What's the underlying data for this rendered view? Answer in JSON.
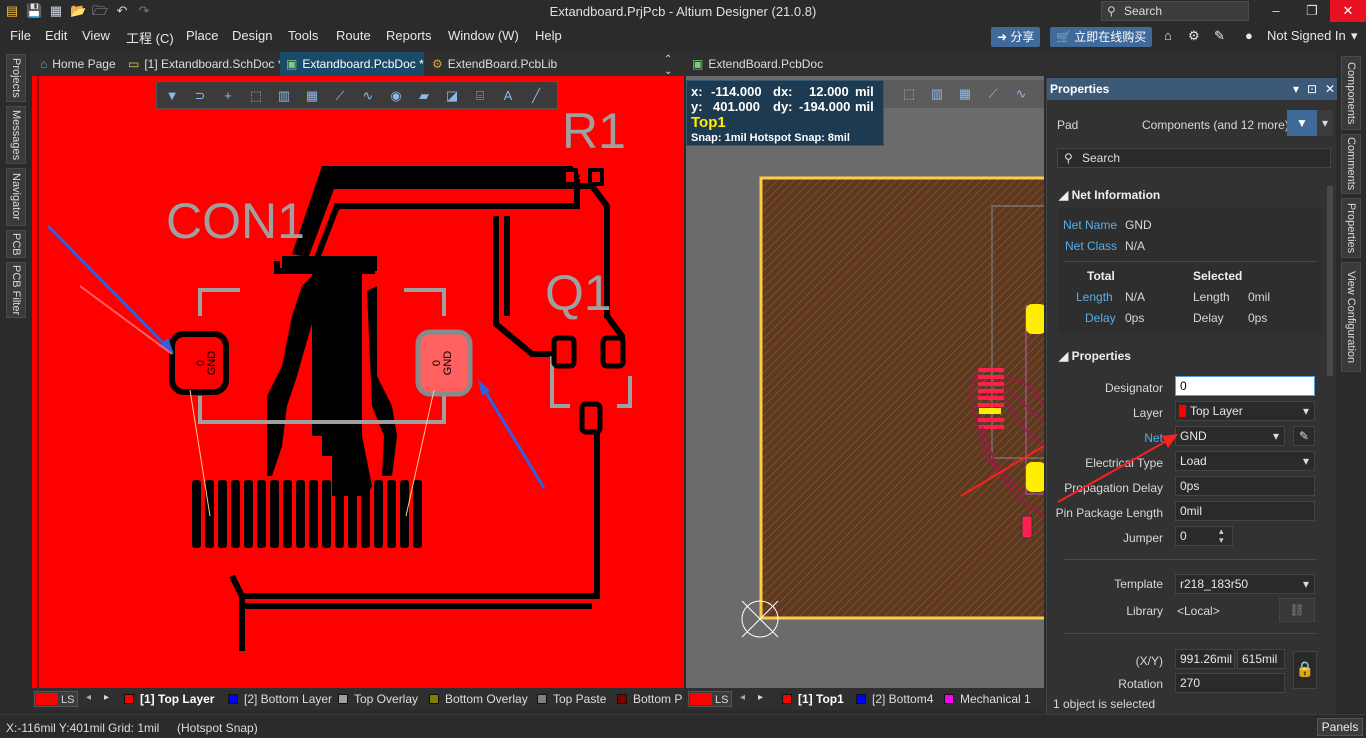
{
  "window": {
    "title": "Extandboard.PrjPcb - Altium Designer (21.0.8)",
    "search_placeholder": "Search",
    "minimize": "–",
    "restore": "❐",
    "close": "✕"
  },
  "menu": {
    "items": [
      "File",
      "Edit",
      "View",
      "工程 (C)",
      "Place",
      "Design",
      "Tools",
      "Route",
      "Reports",
      "Window (W)",
      "Help"
    ],
    "share_label": "分享",
    "buy_label": "立即在线购买",
    "user_label": "Not Signed In"
  },
  "tabs": {
    "left": [
      {
        "label": "Home Page",
        "icon": "home-icon"
      },
      {
        "label": "[1] Extandboard.SchDoc *",
        "icon": "schematic-icon"
      },
      {
        "label": "Extandboard.PcbDoc *",
        "icon": "pcb-icon"
      },
      {
        "label": "ExtendBoard.PcbLib",
        "icon": "library-icon"
      }
    ],
    "right": {
      "label": "ExtendBoard.PcbDoc",
      "icon": "pcb-icon"
    }
  },
  "left_dock": [
    "Projects",
    "Messages",
    "Navigator",
    "PCB",
    "PCB Filter"
  ],
  "right_dock": [
    "Components",
    "Comments",
    "Properties",
    "View Configuration"
  ],
  "pcb_left": {
    "designators": [
      "R1",
      "CON1",
      "Q1"
    ],
    "pad_label_num": "0",
    "pad_label_net": "GND"
  },
  "coords": {
    "x_label": "x:",
    "x_val": "-114.000",
    "dx_label": "dx:",
    "dx_val": "12.000",
    "x_unit": "mil",
    "y_label": "y:",
    "y_val": "401.000",
    "dy_label": "dy:",
    "dy_val": "-194.000",
    "y_unit": "mil",
    "layer": "Top1",
    "snap": "Snap: 1mil Hotspot Snap: 8mil"
  },
  "properties": {
    "header": "Properties",
    "object_type": "Pad",
    "filter_text": "Components (and 12 more)",
    "search_placeholder": "Search",
    "net_info": {
      "title": "Net Information",
      "net_name_label": "Net Name",
      "net_name": "GND",
      "net_class_label": "Net Class",
      "net_class": "N/A",
      "total_label": "Total",
      "selected_label": "Selected",
      "length_label": "Length",
      "length_total": "N/A",
      "length_sel_label": "Length",
      "length_sel": "0mil",
      "delay_label": "Delay",
      "delay_total": "0ps",
      "delay_sel_label": "Delay",
      "delay_sel": "0ps"
    },
    "props": {
      "title": "Properties",
      "designator_label": "Designator",
      "designator": "0",
      "layer_label": "Layer",
      "layer": "Top Layer",
      "net_label": "Net",
      "net": "GND",
      "etype_label": "Electrical Type",
      "etype": "Load",
      "prop_delay_label": "Propagation Delay",
      "prop_delay": "0ps",
      "pin_pkg_label": "Pin Package Length",
      "pin_pkg": "0mil",
      "jumper_label": "Jumper",
      "jumper": "0",
      "template_label": "Template",
      "template": "r218_183r50",
      "library_label": "Library",
      "library": "<Local>",
      "xy_label": "(X/Y)",
      "x": "991.26mil",
      "y": "615mil",
      "rotation_label": "Rotation",
      "rotation": "270"
    },
    "selection_status": "1 object is selected"
  },
  "layer_tabs_left": [
    {
      "label": "[1] Top Layer",
      "color": "#ff0000",
      "active": true
    },
    {
      "label": "[2] Bottom Layer",
      "color": "#0000ff"
    },
    {
      "label": "Top Overlay",
      "color": "#a0a0a0"
    },
    {
      "label": "Bottom Overlay",
      "color": "#808000"
    },
    {
      "label": "Top Paste",
      "color": "#808080"
    },
    {
      "label": "Bottom P",
      "color": "#800000"
    }
  ],
  "layer_tabs_right": [
    {
      "label": "[1] Top1",
      "color": "#ff0000",
      "active": true
    },
    {
      "label": "[2] Bottom4",
      "color": "#0000ff"
    },
    {
      "label": "Mechanical 1",
      "color": "#ff00ff"
    }
  ],
  "ls_label": "LS",
  "status": {
    "coords": "X:-116mil Y:401mil",
    "grid": "Grid: 1mil",
    "snap": "(Hotspot Snap)",
    "panels": "Panels"
  },
  "colors": {
    "board_red": "#ff0000",
    "copper_black": "#000000",
    "overlay_gray": "#a0a0a0",
    "accent_blue": "#3c5a78",
    "annotation_red": "#ff2020",
    "annotation_blue": "#3060e0",
    "layer_yellow": "#ffee00"
  }
}
